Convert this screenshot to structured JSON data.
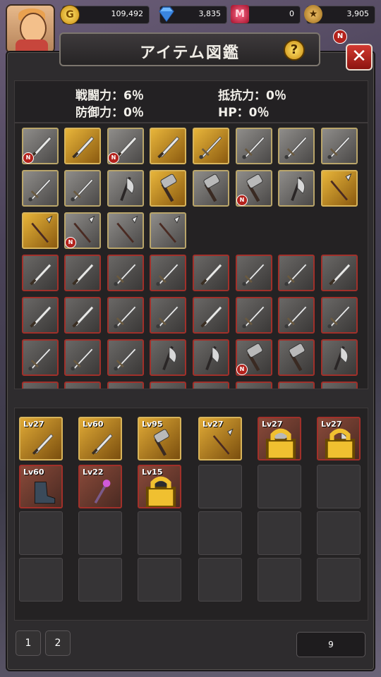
{
  "currencies": {
    "gold": "109,492",
    "gems": "3,835",
    "ruby": "0",
    "medal": "3,905",
    "gold_icon": "G",
    "ruby_icon": "M"
  },
  "header": {
    "title": "アイテム図鑑",
    "help_label": "?",
    "close_label": "✕",
    "new_badge": "N"
  },
  "stats": {
    "attack": "戦闘力：6％",
    "resist": "抵抗力：0％",
    "defense": "防御力：0％",
    "hp": "HP：0％"
  },
  "collection": {
    "rows": [
      [
        {
          "t": "gray",
          "w": "dagger",
          "n": true
        },
        {
          "t": "gold",
          "w": "dagger"
        },
        {
          "t": "gray",
          "w": "dagger",
          "n": true
        },
        {
          "t": "gold",
          "w": "dagger"
        },
        {
          "t": "gold",
          "w": "sword"
        },
        {
          "t": "gray",
          "w": "sword"
        },
        {
          "t": "gray",
          "w": "sword"
        },
        {
          "t": "gray",
          "w": "sword"
        }
      ],
      [
        {
          "t": "gray",
          "w": "sword"
        },
        {
          "t": "gray",
          "w": "sword"
        },
        {
          "t": "gray",
          "w": "axe"
        },
        {
          "t": "gold",
          "w": "hammer"
        },
        {
          "t": "gray",
          "w": "hammer"
        },
        {
          "t": "gray",
          "w": "hammer",
          "n": true
        },
        {
          "t": "gray",
          "w": "axe"
        },
        {
          "t": "gold",
          "w": "spear"
        }
      ],
      [
        {
          "t": "gold",
          "w": "spear"
        },
        {
          "t": "gray",
          "w": "spear",
          "n": true
        },
        {
          "t": "gray",
          "w": "spear"
        },
        {
          "t": "gray",
          "w": "spear"
        }
      ],
      [
        {
          "t": "lock",
          "w": "dagger"
        },
        {
          "t": "lock",
          "w": "dagger"
        },
        {
          "t": "lock",
          "w": "sword"
        },
        {
          "t": "lock",
          "w": "sword"
        },
        {
          "t": "lock",
          "w": "dagger"
        },
        {
          "t": "lock",
          "w": "sword"
        },
        {
          "t": "lock",
          "w": "sword"
        },
        {
          "t": "lock",
          "w": "dagger"
        }
      ],
      [
        {
          "t": "lock",
          "w": "dagger"
        },
        {
          "t": "lock",
          "w": "dagger"
        },
        {
          "t": "lock",
          "w": "sword"
        },
        {
          "t": "lock",
          "w": "sword"
        },
        {
          "t": "lock",
          "w": "dagger"
        },
        {
          "t": "lock",
          "w": "sword"
        },
        {
          "t": "lock",
          "w": "sword"
        },
        {
          "t": "lock",
          "w": "sword"
        }
      ],
      [
        {
          "t": "lock",
          "w": "sword"
        },
        {
          "t": "lock",
          "w": "sword"
        },
        {
          "t": "lock",
          "w": "sword"
        },
        {
          "t": "lock",
          "w": "axe"
        },
        {
          "t": "lock",
          "w": "axe"
        },
        {
          "t": "lock",
          "w": "hammer",
          "n": true
        },
        {
          "t": "lock",
          "w": "hammer"
        },
        {
          "t": "lock",
          "w": "axe"
        }
      ],
      [
        {
          "t": "lock",
          "w": "sword"
        },
        {
          "t": "lock",
          "w": "sword"
        },
        {
          "t": "lock",
          "w": "sword"
        },
        {
          "t": "lock",
          "w": "sword"
        },
        {
          "t": "lock",
          "w": "sword"
        },
        {
          "t": "lock",
          "w": "sword"
        },
        {
          "t": "lock",
          "w": "sword"
        },
        {
          "t": "lock",
          "w": "sword"
        }
      ]
    ]
  },
  "inventory": {
    "slots": [
      {
        "lv": "Lv27",
        "t": "gold",
        "w": "dagger",
        "lock": false
      },
      {
        "lv": "Lv60",
        "t": "gold",
        "w": "dagger",
        "lock": false
      },
      {
        "lv": "Lv95",
        "t": "gold",
        "w": "hammer",
        "lock": false
      },
      {
        "lv": "Lv27",
        "t": "gold",
        "w": "spear",
        "lock": false
      },
      {
        "lv": "Lv27",
        "t": "red",
        "w": "hammer",
        "lock": true
      },
      {
        "lv": "Lv27",
        "t": "red",
        "w": "axe",
        "lock": true
      },
      {
        "lv": "Lv60",
        "t": "red",
        "w": "boot",
        "lock": false
      },
      {
        "lv": "Lv22",
        "t": "red",
        "w": "staff",
        "lock": false
      },
      {
        "lv": "Lv15",
        "t": "red",
        "w": "glove",
        "lock": true
      }
    ]
  },
  "pager": {
    "page1": "1",
    "page2": "2",
    "count": "9"
  }
}
